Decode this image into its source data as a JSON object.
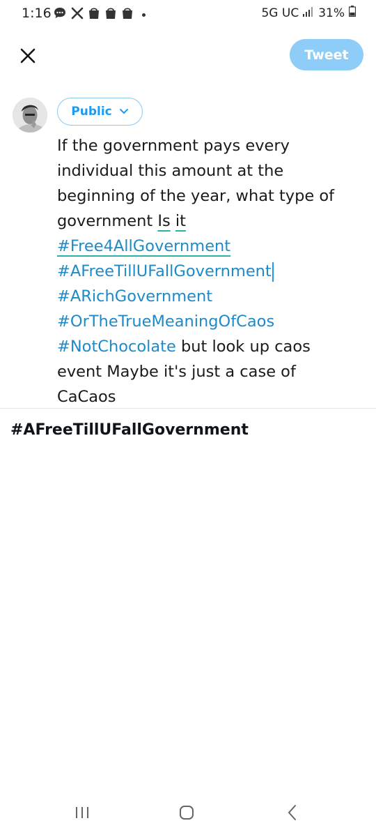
{
  "status_bar": {
    "time": "1:16",
    "network": "5G UC",
    "battery": "31%",
    "notification_icons": [
      "chat-bubble-icon",
      "x-logo-icon",
      "shopping-bag-icon",
      "shopping-bag-icon",
      "shopping-bag-icon"
    ]
  },
  "header": {
    "close_icon": "close-icon",
    "tweet_label": "Tweet",
    "tweet_color": "#8ecdf7"
  },
  "composer": {
    "audience_label": "Public",
    "lines": [
      "If the government pays every",
      "individual this amount at the",
      "beginning of the year, what type of",
      "government ",
      "Is",
      "it",
      "#Free4AllGovernment",
      "#AFreeTillUFallGovernment",
      "#ARichGovernment",
      "#OrTheTrueMeaningOfCaos",
      "#NotChocolate",
      " but look up caos",
      "event Maybe it's just a case of",
      "CaCaos"
    ],
    "hashtag_color": "#1d8ac9"
  },
  "suggestion": {
    "label": "#AFreeTillUFallGovernment"
  },
  "nav_bar": {
    "icons": [
      "recent-apps-icon",
      "home-icon",
      "back-icon"
    ]
  }
}
